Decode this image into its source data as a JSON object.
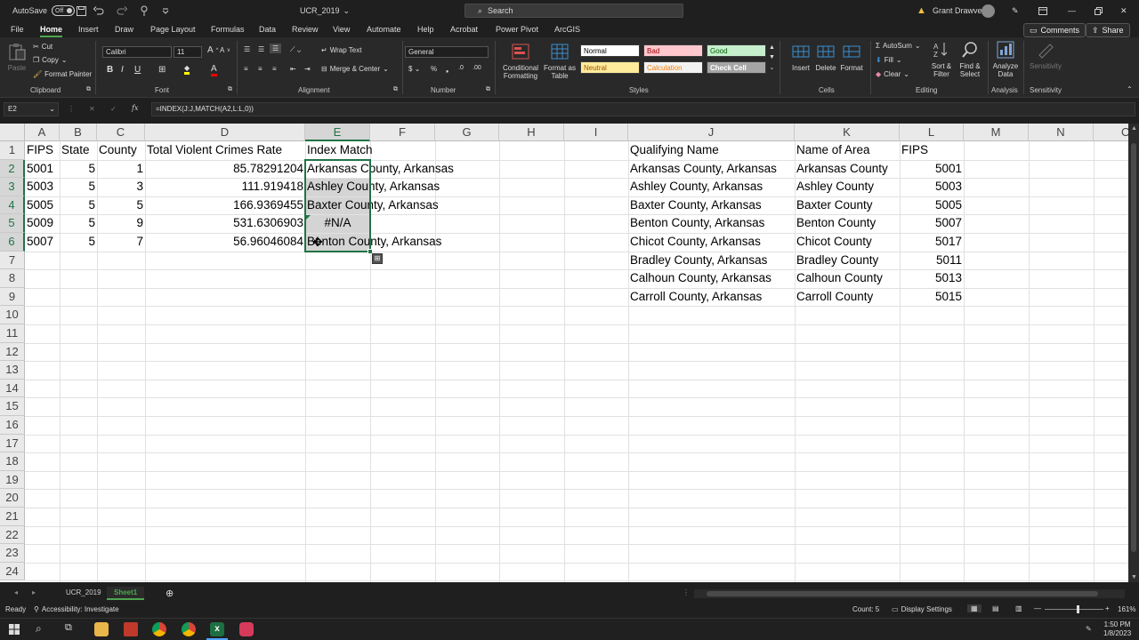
{
  "titlebar": {
    "autosave_label": "AutoSave",
    "autosave_state": "Off",
    "file_name": "UCR_2019",
    "search_placeholder": "Search",
    "user_name": "Grant Drawve"
  },
  "menu": {
    "tabs": [
      "File",
      "Home",
      "Insert",
      "Draw",
      "Page Layout",
      "Formulas",
      "Data",
      "Review",
      "View",
      "Automate",
      "Help",
      "Acrobat",
      "Power Pivot",
      "ArcGIS"
    ],
    "active": "Home",
    "comments_label": "Comments",
    "share_label": "Share"
  },
  "ribbon": {
    "clipboard": {
      "paste": "Paste",
      "cut": "Cut",
      "copy": "Copy",
      "format_painter": "Format Painter",
      "label": "Clipboard"
    },
    "font": {
      "name": "Calibri",
      "size": "11",
      "label": "Font"
    },
    "alignment": {
      "wrap_text": "Wrap Text",
      "merge_center": "Merge & Center",
      "label": "Alignment"
    },
    "number": {
      "format": "General",
      "label": "Number"
    },
    "styles": {
      "conditional_formatting": "Conditional Formatting",
      "format_as_table": "Format as Table",
      "cells": [
        {
          "name": "Normal",
          "bg": "#ffffff",
          "fg": "#000000"
        },
        {
          "name": "Bad",
          "bg": "#ffc7ce",
          "fg": "#9c0006"
        },
        {
          "name": "Good",
          "bg": "#c6efce",
          "fg": "#006100"
        },
        {
          "name": "Neutral",
          "bg": "#ffeb9c",
          "fg": "#9c5700"
        },
        {
          "name": "Calculation",
          "bg": "#f2f2f2",
          "fg": "#fa7d00"
        },
        {
          "name": "Check Cell",
          "bg": "#a5a5a5",
          "fg": "#ffffff"
        }
      ],
      "label": "Styles"
    },
    "cells": {
      "insert": "Insert",
      "delete": "Delete",
      "format": "Format",
      "label": "Cells"
    },
    "editing": {
      "autosum": "AutoSum",
      "fill": "Fill",
      "clear": "Clear",
      "sort_filter": "Sort & Filter",
      "find_select": "Find & Select",
      "label": "Editing"
    },
    "analysis": {
      "analyze_data": "Analyze Data",
      "label": "Analysis"
    },
    "sensitivity": {
      "button": "Sensitivity",
      "label": "Sensitivity"
    }
  },
  "formula_bar": {
    "name_box": "E2",
    "formula": "=INDEX(J:J,MATCH(A2,L:L,0))"
  },
  "sheet": {
    "columns": [
      "A",
      "B",
      "C",
      "D",
      "E",
      "F",
      "G",
      "H",
      "I",
      "J",
      "K",
      "L",
      "M",
      "N",
      "O"
    ],
    "rows": [
      "1",
      "2",
      "3",
      "4",
      "5",
      "6",
      "7",
      "8",
      "9",
      "10",
      "11",
      "12",
      "13",
      "14",
      "15",
      "16",
      "17",
      "18",
      "19",
      "20",
      "21",
      "22",
      "23",
      "24"
    ],
    "header": {
      "A": "FIPS",
      "B": "State",
      "C": "County",
      "D": "Total Violent Crimes Rate",
      "E": "Index Match",
      "J": "Qualifying Name",
      "K": "Name of Area",
      "L": "FIPS"
    },
    "left_rows": [
      {
        "A": "5001",
        "B": "5",
        "C": "1",
        "D": "85.78291204",
        "E": "Arkansas County, Arkansas"
      },
      {
        "A": "5003",
        "B": "5",
        "C": "3",
        "D": "111.919418",
        "E": "Ashley County, Arkansas"
      },
      {
        "A": "5005",
        "B": "5",
        "C": "5",
        "D": "166.9369455",
        "E": "Baxter County, Arkansas"
      },
      {
        "A": "5009",
        "B": "5",
        "C": "9",
        "D": "531.6306903",
        "E": "#N/A"
      },
      {
        "A": "5007",
        "B": "5",
        "C": "7",
        "D": "56.96046084",
        "E": "Benton County, Arkansas"
      }
    ],
    "right_rows": [
      {
        "J": "Arkansas County, Arkansas",
        "K": "Arkansas County",
        "L": "5001"
      },
      {
        "J": "Ashley County, Arkansas",
        "K": "Ashley County",
        "L": "5003"
      },
      {
        "J": "Baxter County, Arkansas",
        "K": "Baxter County",
        "L": "5005"
      },
      {
        "J": "Benton County, Arkansas",
        "K": "Benton County",
        "L": "5007"
      },
      {
        "J": "Chicot County, Arkansas",
        "K": "Chicot County",
        "L": "5017"
      },
      {
        "J": "Bradley County, Arkansas",
        "K": "Bradley County",
        "L": "5011"
      },
      {
        "J": "Calhoun County, Arkansas",
        "K": "Calhoun County",
        "L": "5013"
      },
      {
        "J": "Carroll County, Arkansas",
        "K": "Carroll County",
        "L": "5015"
      }
    ]
  },
  "sheet_tabs": {
    "tabs": [
      "UCR_2019",
      "Sheet1"
    ],
    "active": "Sheet1"
  },
  "status": {
    "ready": "Ready",
    "accessibility": "Accessibility: Investigate",
    "count": "Count: 5",
    "display_settings": "Display Settings",
    "zoom": "161%"
  },
  "taskbar": {
    "time": "1:50 PM",
    "date": "1/8/2023"
  }
}
